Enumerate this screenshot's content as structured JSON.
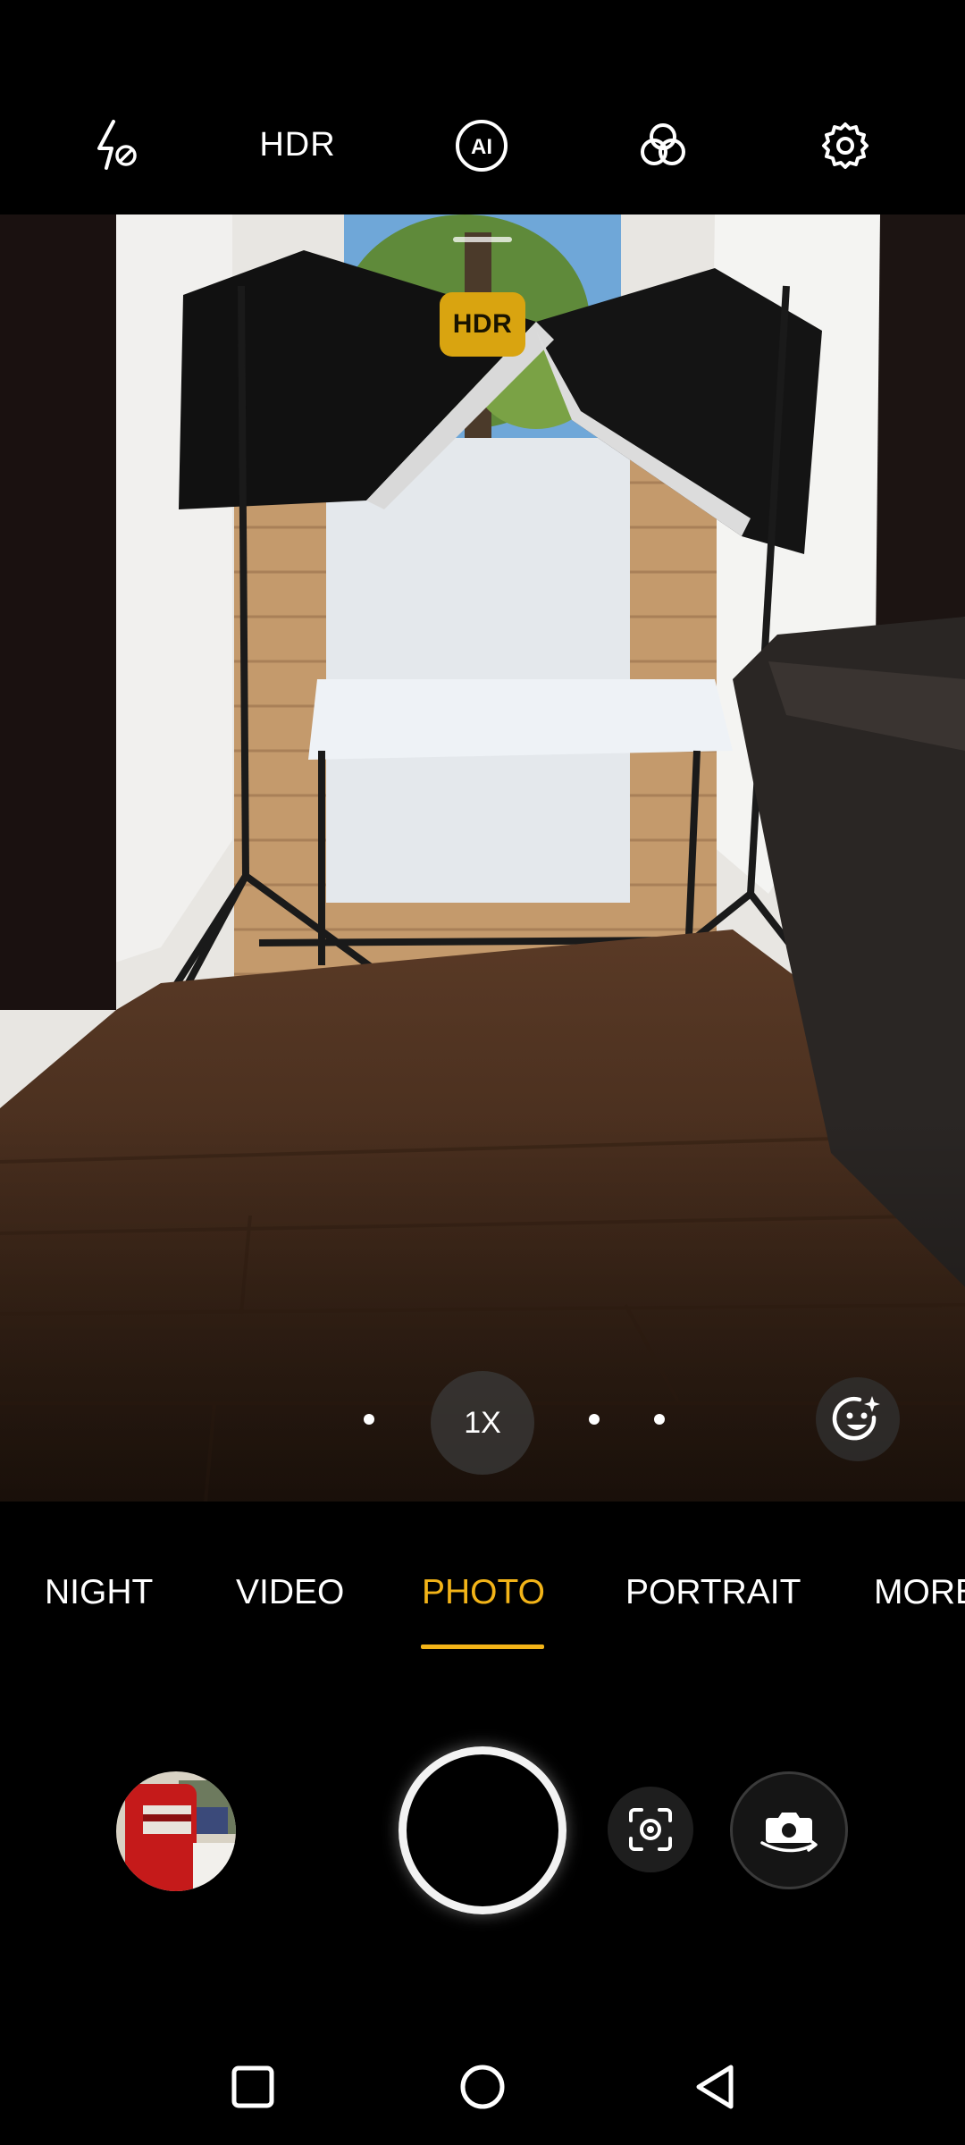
{
  "top_bar": {
    "flash_icon": "flash-off-icon",
    "hdr_label": "HDR",
    "ai_icon": "ai-scene-icon",
    "ai_label": "AI",
    "filters_icon": "filters-icon",
    "settings_icon": "gear-icon"
  },
  "viewfinder": {
    "hdr_badge": "HDR",
    "zoom_label": "1X",
    "beauty_icon": "face-sparkle-icon"
  },
  "modes": [
    {
      "label": "NIGHT",
      "active": false
    },
    {
      "label": "VIDEO",
      "active": false
    },
    {
      "label": "PHOTO",
      "active": true
    },
    {
      "label": "PORTRAIT",
      "active": false
    },
    {
      "label": "MORE",
      "active": false
    }
  ],
  "controls": {
    "gallery_icon": "gallery-thumbnail",
    "shutter_icon": "shutter-button",
    "lens_icon": "lens-scan-icon",
    "flip_icon": "camera-flip-icon"
  },
  "nav": {
    "recents_icon": "square-icon",
    "home_icon": "circle-icon",
    "back_icon": "triangle-back-icon"
  },
  "colors": {
    "accent": "#f3b418",
    "hdr_badge": "#d9a410",
    "background": "#000000"
  }
}
